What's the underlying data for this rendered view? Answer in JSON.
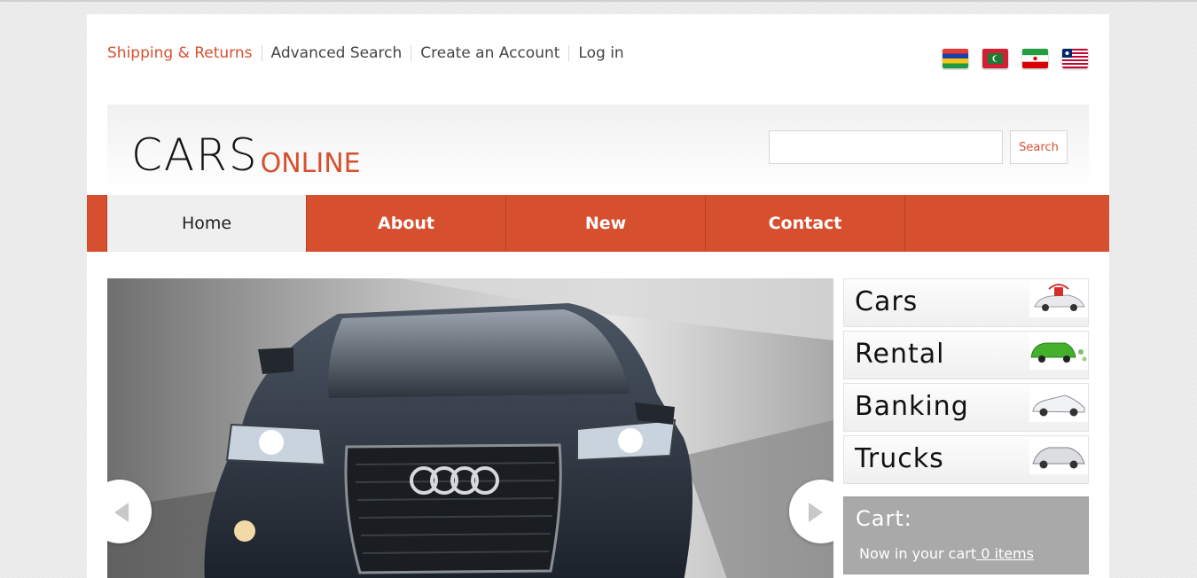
{
  "top_links": {
    "shipping": "Shipping & Returns",
    "advanced_search": "Advanced Search",
    "create_account": "Create an Account",
    "log_in": "Log in"
  },
  "flags": [
    "mauritius-flag-icon",
    "maldives-flag-icon",
    "iran-flag-icon",
    "liberia-flag-icon"
  ],
  "logo": {
    "main": "CARS",
    "sub": "ONLINE"
  },
  "search": {
    "button_label": "Search",
    "value": "",
    "placeholder": ""
  },
  "nav": {
    "home": "Home",
    "about": "About",
    "new": "New",
    "contact": "Contact"
  },
  "categories": {
    "cars": "Cars",
    "rental": "Rental",
    "banking": "Banking",
    "trucks": "Trucks"
  },
  "cart": {
    "title": "Cart:",
    "text": "Now in your cart",
    "count": " 0 items"
  },
  "colors": {
    "accent": "#d6502f",
    "nav_active_bg": "#efefef",
    "cart_bg": "#a9a9a9"
  }
}
